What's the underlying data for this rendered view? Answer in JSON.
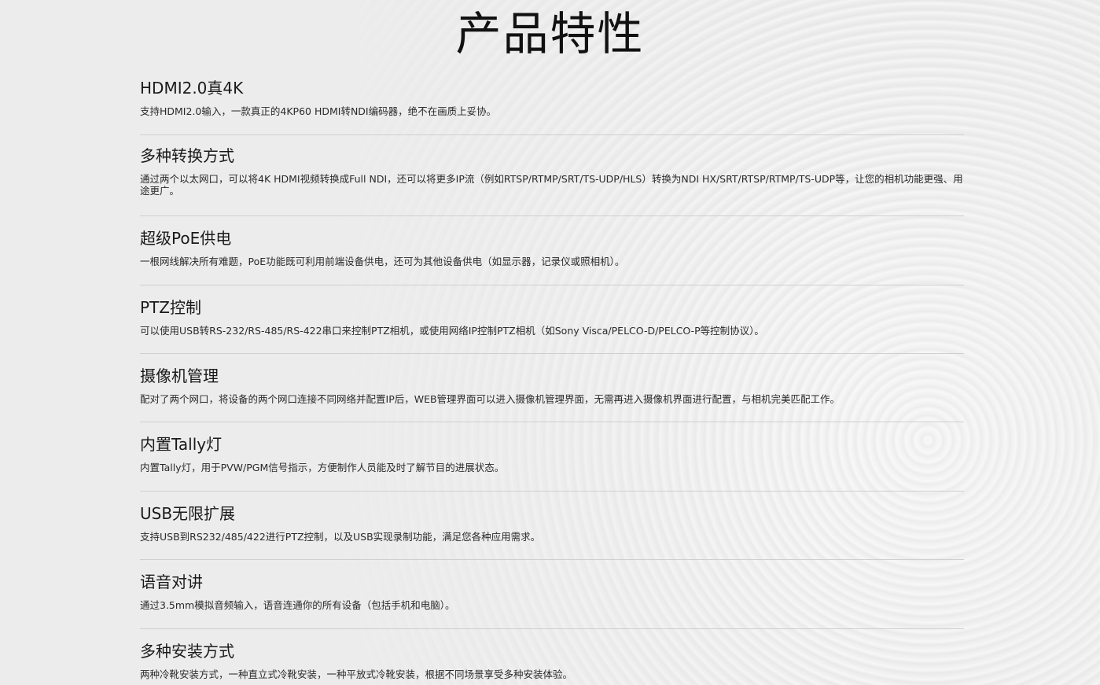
{
  "page": {
    "title": "产品特性"
  },
  "features": [
    {
      "title": "HDMI2.0真4K",
      "desc": "支持HDMI2.0输入，一款真正的4KP60 HDMI转NDI编码器，绝不在画质上妥协。"
    },
    {
      "title": "多种转换方式",
      "desc": "通过两个以太网口，可以将4K HDMI视频转换成Full NDI，还可以将更多IP流（例如RTSP/RTMP/SRT/TS-UDP/HLS）转换为NDI HX/SRT/RTSP/RTMP/TS-UDP等，让您的相机功能更强、用途更广。"
    },
    {
      "title": "超级PoE供电",
      "desc": "一根网线解决所有难题，PoE功能既可利用前端设备供电，还可为其他设备供电（如显示器，记录仪或照相机）。"
    },
    {
      "title": "PTZ控制",
      "desc": "可以使用USB转RS-232/RS-485/RS-422串口来控制PTZ相机，或使用网络IP控制PTZ相机（如Sony Visca/PELCO-D/PELCO-P等控制协议）。"
    },
    {
      "title": "摄像机管理",
      "desc": "配对了两个网口，将设备的两个网口连接不同网络并配置IP后，WEB管理界面可以进入摄像机管理界面，无需再进入摄像机界面进行配置，与相机完美匹配工作。"
    },
    {
      "title": "内置Tally灯",
      "desc": "内置Tally灯，用于PVW/PGM信号指示，方便制作人员能及时了解节目的进展状态。"
    },
    {
      "title": "USB无限扩展",
      "desc": "支持USB到RS232/485/422进行PTZ控制，以及USB实现录制功能，满足您各种应用需求。"
    },
    {
      "title": "语音对讲",
      "desc": "通过3.5mm模拟音频输入，语音连通你的所有设备（包括手机和电脑）。"
    },
    {
      "title": "多种安装方式",
      "desc": "两种冷靴安装方式，一种直立式冷靴安装，一种平放式冷靴安装，根据不同场景享受多种安装体验。"
    }
  ]
}
